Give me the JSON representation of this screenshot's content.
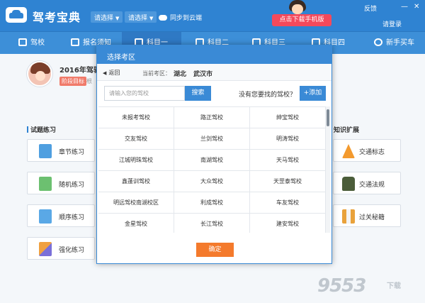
{
  "app": {
    "title": "驾考宝典",
    "select1": "请选择",
    "select2": "请选择",
    "sync": "同步到云端",
    "download_btn": "点击下载手机版",
    "feedback": "反馈",
    "login": "请登录",
    "minimize": "—",
    "close": "✕"
  },
  "nav": {
    "items": [
      {
        "label": "驾校"
      },
      {
        "label": "报名须知"
      },
      {
        "label": "科目一"
      },
      {
        "label": "科目二"
      },
      {
        "label": "科目三"
      },
      {
        "label": "科目四"
      },
      {
        "label": "新手买车"
      }
    ]
  },
  "profile": {
    "title": "2016年驾驶",
    "stage_badge": "阶段目标",
    "stage_extra": "根"
  },
  "sections": {
    "left_title": "试题练习",
    "right_title": "知识扩展"
  },
  "tiles_left": [
    {
      "label": "章节练习",
      "icon": "chapter-icon"
    },
    {
      "label": "随机练习",
      "icon": "random-icon"
    },
    {
      "label": "顺序练习",
      "icon": "order-icon"
    },
    {
      "label": "强化练习",
      "icon": "strengthen-icon"
    }
  ],
  "tiles_right": [
    {
      "label": "交通标志",
      "icon": "traffic-cone-icon"
    },
    {
      "label": "交通法规",
      "icon": "police-icon"
    },
    {
      "label": "过关秘籍",
      "icon": "book-icon"
    }
  ],
  "dialog": {
    "title": "选择考区",
    "back": "返回",
    "current_label": "当前考区：",
    "province": "湖北",
    "city": "武汉市",
    "search_placeholder": "请输入您的驾校",
    "search_btn": "搜索",
    "not_found": "没有您要找的驾校？",
    "add_btn": "+添加",
    "ok_btn": "确定",
    "schools": [
      "未报考驾校",
      "路正驾校",
      "绅宝驾校",
      "交友驾校",
      "兰剑驾校",
      "明涛驾校",
      "江城明珠驾校",
      "南湖驾校",
      "天马驾校",
      "鑫蓬训驾校",
      "大众驾校",
      "天罡泰驾校",
      "明远驾校南湖校区",
      "利成驾校",
      "车友驾校",
      "金星驾校",
      "长江驾校",
      "建安驾校"
    ]
  },
  "watermark": {
    "text": "9553",
    "sub": "下载"
  },
  "colors": {
    "primary": "#2f83d2",
    "dialog_blue": "#3a8ad6",
    "download_red": "#f4495b",
    "ok_orange": "#f47a2c"
  }
}
